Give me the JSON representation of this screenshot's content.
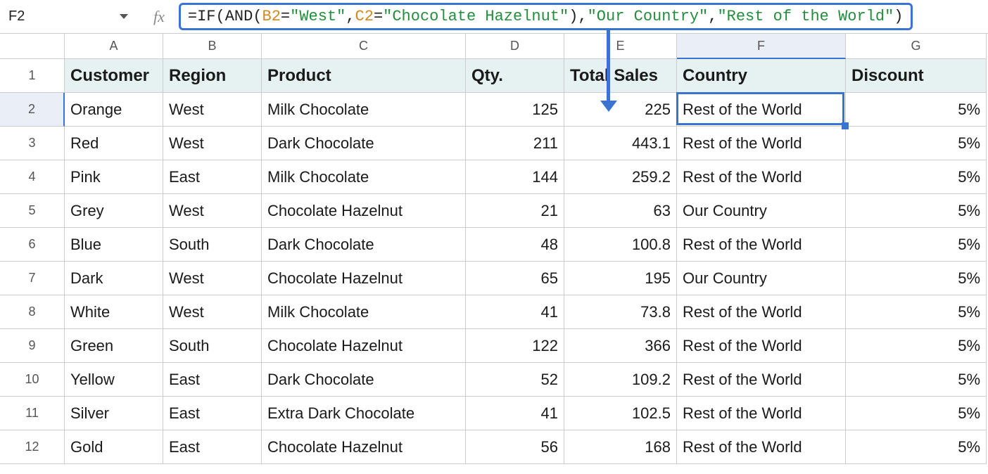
{
  "nameBox": "F2",
  "formula": {
    "prefix": "=",
    "fnIf": "IF",
    "fnAnd": "AND",
    "ref1": "B2",
    "eq": "=",
    "str1": "\"West\"",
    "comma": ",",
    "ref2": "C2",
    "str2": "\"Chocolate Hazelnut\"",
    "str3": "\"Our Country\"",
    "str4": "\"Rest of the World\"",
    "open": "(",
    "close": ")"
  },
  "columns": [
    "A",
    "B",
    "C",
    "D",
    "E",
    "F",
    "G"
  ],
  "rowNumbers": [
    "1",
    "2",
    "3",
    "4",
    "5",
    "6",
    "7",
    "8",
    "9",
    "10",
    "11",
    "12"
  ],
  "headers": {
    "A": "Customer",
    "B": "Region",
    "C": "Product",
    "D": "Qty.",
    "E": "Total Sales",
    "F": "Country",
    "G": "Discount"
  },
  "rows": [
    {
      "A": "Orange",
      "B": "West",
      "C": "Milk Chocolate",
      "D": "125",
      "E": "225",
      "F": "Rest of the World",
      "G": "5%"
    },
    {
      "A": "Red",
      "B": "West",
      "C": "Dark Chocolate",
      "D": "211",
      "E": "443.1",
      "F": "Rest of the World",
      "G": "5%"
    },
    {
      "A": "Pink",
      "B": "East",
      "C": "Milk Chocolate",
      "D": "144",
      "E": "259.2",
      "F": "Rest of the World",
      "G": "5%"
    },
    {
      "A": "Grey",
      "B": "West",
      "C": "Chocolate Hazelnut",
      "D": "21",
      "E": "63",
      "F": "Our Country",
      "G": "5%"
    },
    {
      "A": "Blue",
      "B": "South",
      "C": "Dark Chocolate",
      "D": "48",
      "E": "100.8",
      "F": "Rest of the World",
      "G": "5%"
    },
    {
      "A": "Dark",
      "B": "West",
      "C": "Chocolate Hazelnut",
      "D": "65",
      "E": "195",
      "F": "Our Country",
      "G": "5%"
    },
    {
      "A": "White",
      "B": "West",
      "C": "Milk Chocolate",
      "D": "41",
      "E": "73.8",
      "F": "Rest of the World",
      "G": "5%"
    },
    {
      "A": "Green",
      "B": "South",
      "C": "Chocolate Hazelnut",
      "D": "122",
      "E": "366",
      "F": "Rest of the World",
      "G": "5%"
    },
    {
      "A": "Yellow",
      "B": "East",
      "C": "Dark Chocolate",
      "D": "52",
      "E": "109.2",
      "F": "Rest of the World",
      "G": "5%"
    },
    {
      "A": "Silver",
      "B": "East",
      "C": "Extra Dark Chocolate",
      "D": "41",
      "E": "102.5",
      "F": "Rest of the World",
      "G": "5%"
    },
    {
      "A": "Gold",
      "B": "East",
      "C": "Chocolate Hazelnut",
      "D": "56",
      "E": "168",
      "F": "Rest of the World",
      "G": "5%"
    }
  ],
  "selectedCell": "F2",
  "selectedCol": "F",
  "selectedRow": "2"
}
